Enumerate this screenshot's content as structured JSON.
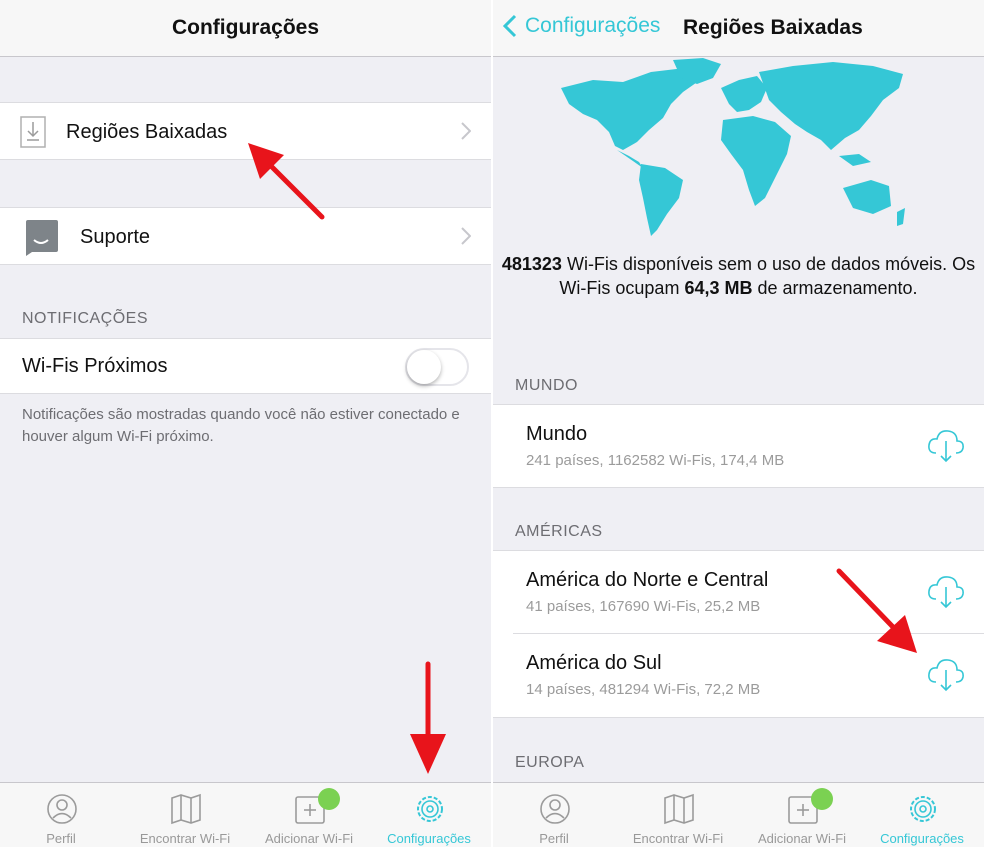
{
  "colors": {
    "accent": "#35c7d6",
    "map": "#35c7d6",
    "badge": "#7bd152",
    "arrow": "#e8141b",
    "background": "#efeff4"
  },
  "left": {
    "title": "Configurações",
    "rows": {
      "downloaded_regions": {
        "label": "Regiões Baixadas",
        "icon": "download-tray-icon"
      },
      "support": {
        "label": "Suporte",
        "icon": "chat-bubble-icon"
      }
    },
    "notifications": {
      "header": "NOTIFICAÇÕES",
      "nearby_label": "Wi-Fis Próximos",
      "toggle_on": false,
      "footnote": "Notificações são mostradas quando você não estiver conectado e houver algum Wi-Fi próximo."
    }
  },
  "right": {
    "back_label": "Configurações",
    "title": "Regiões Baixadas",
    "summary": {
      "count": "481323",
      "text1": " Wi-Fis disponíveis sem o uso de dados móveis. Os Wi-Fis ocupam ",
      "size": "64,3 MB",
      "text2": " de armazenamento."
    },
    "sections": {
      "world": {
        "header": "MUNDO",
        "items": [
          {
            "name": "Mundo",
            "details": "241 países, 1162582 Wi-Fis, 174,4 MB"
          }
        ]
      },
      "americas": {
        "header": "AMÉRICAS",
        "items": [
          {
            "name": "América do Norte e Central",
            "details": "41 países, 167690 Wi-Fis, 25,2 MB"
          },
          {
            "name": "América do Sul",
            "details": "14 países, 481294 Wi-Fis, 72,2 MB"
          }
        ]
      },
      "europe": {
        "header": "EUROPA"
      }
    }
  },
  "tabbar": {
    "tabs": [
      {
        "label": "Perfil",
        "icon": "person-icon"
      },
      {
        "label": "Encontrar Wi-Fi",
        "icon": "map-icon"
      },
      {
        "label": "Adicionar Wi-Fi",
        "icon": "add-wifi-icon"
      },
      {
        "label": "Configurações",
        "icon": "gear-icon"
      }
    ],
    "active_tab": "Configurações"
  }
}
